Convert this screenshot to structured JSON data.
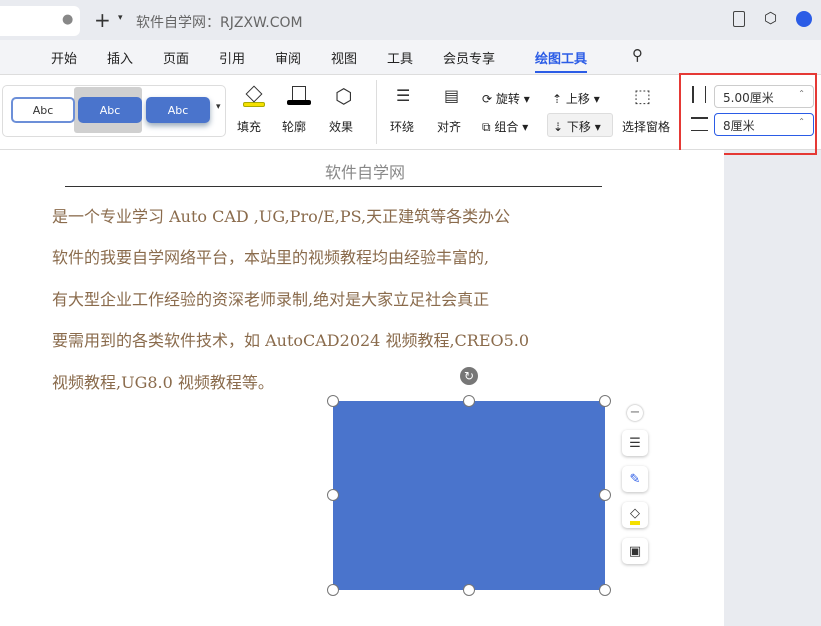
{
  "titlebar": {
    "site": "软件自学网：RJZXW.COM",
    "new_tab": "+"
  },
  "menu": [
    "开始",
    "插入",
    "页面",
    "引用",
    "审阅",
    "视图",
    "工具",
    "会员专享",
    "绘图工具"
  ],
  "ribbon": {
    "styles": [
      "Abc",
      "Abc",
      "Abc"
    ],
    "fill": "填充",
    "outline": "轮廓",
    "effect": "效果",
    "wrap": "环绕",
    "align": "对齐",
    "rotate": "旋转",
    "group": "组合",
    "move_up": "上移",
    "move_down": "下移",
    "selection_pane": "选择窗格",
    "height_value": "5.00厘米",
    "width_value": "8厘米"
  },
  "document": {
    "title": "软件自学网",
    "lines": [
      "是一个专业学习 Auto CAD ,UG,Pro/E,PS,天正建筑等各类办公",
      "软件的我要自学网络平台，本站里的视频教程均由经验丰富的,",
      "有大型企业工作经验的资深老师录制,绝对是大家立足社会真正",
      "要需用到的各类软件技术，如 AutoCAD2024 视频教程,CREO5.0",
      "视频教程,UG8.0 视频教程等。"
    ]
  },
  "colors": {
    "accent": "#2b5ce6",
    "shape": "#4a74cc",
    "highlight": "#e53935"
  }
}
